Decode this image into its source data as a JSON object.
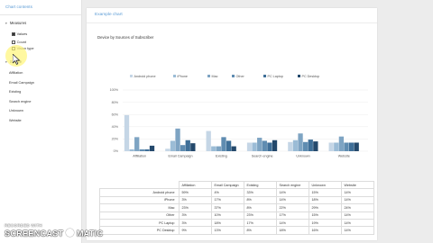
{
  "sidebar": {
    "header": "Chart contents",
    "measures": {
      "title": "Measures",
      "items": [
        {
          "label": "Values",
          "checked": true
        },
        {
          "label": "Count",
          "checked": false
        },
        {
          "label": "Vision type",
          "checked": false
        }
      ]
    },
    "source": {
      "title": "Source",
      "items": [
        "Affiliation",
        "Email Campaign",
        "Existing",
        "Search engine",
        "Unknown",
        "Website"
      ]
    }
  },
  "main": {
    "header": "Example chart",
    "chart_title": "Device by Sources of Subscriber"
  },
  "chart_data": {
    "type": "bar",
    "categories": [
      "Affiliation",
      "Email Campaign",
      "Existing",
      "Search engine",
      "Unknown",
      "Website"
    ],
    "series": [
      {
        "name": "Android phone",
        "color": "#c5d6e6",
        "values": [
          59,
          4,
          33,
          14,
          15,
          14
        ]
      },
      {
        "name": "iPhone",
        "color": "#9bbcd6",
        "values": [
          3,
          17,
          8,
          14,
          18,
          14
        ]
      },
      {
        "name": "Mac",
        "color": "#7ea4c3",
        "values": [
          23,
          37,
          8,
          22,
          29,
          24
        ]
      },
      {
        "name": "Other",
        "color": "#5f8cb1",
        "values": [
          3,
          10,
          23,
          17,
          15,
          14
        ]
      },
      {
        "name": "PC Laptop",
        "color": "#3f6f98",
        "values": [
          3,
          18,
          17,
          14,
          19,
          14
        ]
      },
      {
        "name": "PC Desktop",
        "color": "#24496c",
        "values": [
          9,
          13,
          8,
          18,
          16,
          14
        ]
      }
    ],
    "y_ticks": [
      "100%",
      "80%",
      "60%",
      "40%",
      "20%",
      "0%"
    ],
    "ylim": [
      0,
      100
    ],
    "grid": true,
    "legend_position": "top"
  }
}
